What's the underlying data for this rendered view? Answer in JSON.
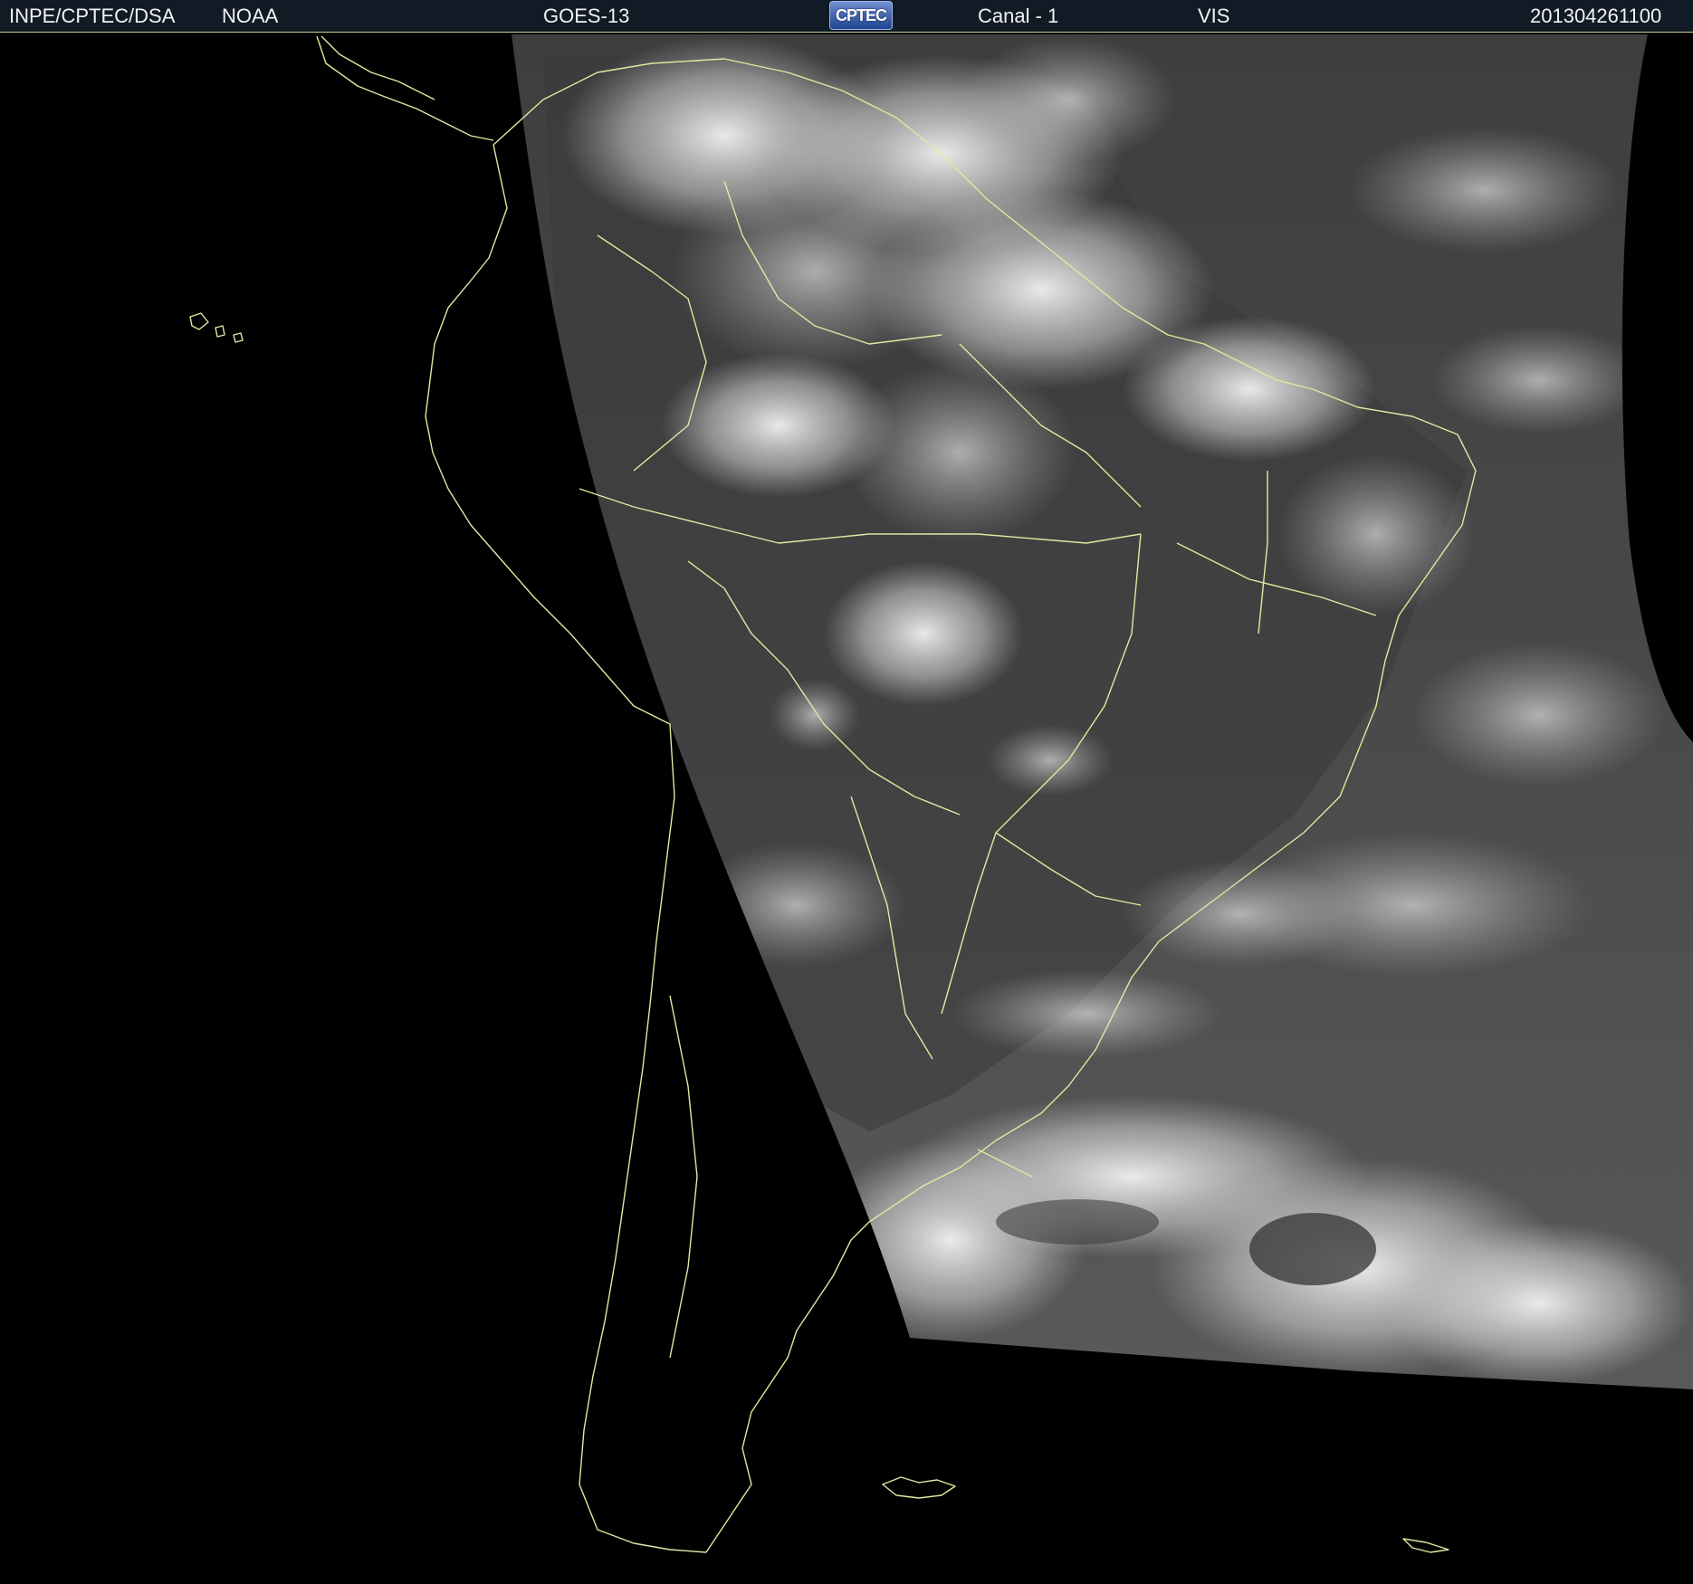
{
  "header": {
    "institution": "INPE/CPTEC/DSA",
    "agency": "NOAA",
    "satellite": "GOES-13",
    "logo_text": "CPTEC",
    "channel": "Canal - 1",
    "band": "VIS",
    "timestamp": "201304261100"
  },
  "colors": {
    "header_background": "#111b26",
    "header_text": "#f2f2f2",
    "coastline": "#e6e6a0",
    "night_background": "#000000"
  },
  "icons": {
    "logo": "cptec-logo-icon"
  }
}
